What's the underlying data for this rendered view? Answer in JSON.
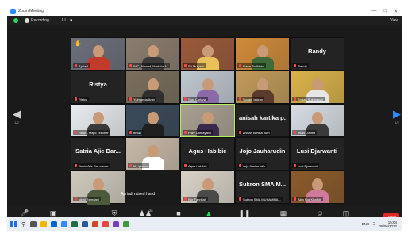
{
  "window": {
    "title": "Zoom Meeting",
    "controls": [
      "—",
      "□",
      "✕"
    ]
  },
  "topbar": {
    "recording": "Recording...",
    "pause": "II ■",
    "view": "View"
  },
  "pager": {
    "left_page": "1/2",
    "right_page": "1/2"
  },
  "tiles": [
    {
      "name": "Apriadi",
      "big": "",
      "kind": "video",
      "hand": true
    },
    {
      "name": "IMC_Ahmad Muntaha M.",
      "big": "",
      "kind": "video"
    },
    {
      "name": "Sri Mulyani",
      "big": "",
      "kind": "video"
    },
    {
      "name": "Liana Rofiktiani",
      "big": "",
      "kind": "video"
    },
    {
      "name": "Randy",
      "big": "Randy",
      "kind": "name"
    },
    {
      "name": "Ristya",
      "big": "Ristya",
      "kind": "name"
    },
    {
      "name": "Yulmanda Amir",
      "big": "",
      "kind": "video"
    },
    {
      "name": "Susi Coriana",
      "big": "",
      "kind": "video"
    },
    {
      "name": "Suyadi Iskiran",
      "big": "",
      "kind": "video"
    },
    {
      "name": "Endah Sukmawati",
      "big": "",
      "kind": "video"
    },
    {
      "name": "RBBI - Majid Teacher",
      "big": "",
      "kind": "video"
    },
    {
      "name": "Ifhida",
      "big": "",
      "kind": "video"
    },
    {
      "name": "Fuzy Damayanti",
      "big": "",
      "kind": "video",
      "active": true
    },
    {
      "name": "anisah kartika putri",
      "big": "anisah kartika p...",
      "kind": "name"
    },
    {
      "name": "Intan Dinima",
      "big": "",
      "kind": "video"
    },
    {
      "name": "Satria Ajie Darmawan",
      "big": "Satria Ajie Dar...",
      "kind": "name"
    },
    {
      "name": "My iphone",
      "big": "",
      "kind": "video"
    },
    {
      "name": "Agus Habibie",
      "big": "Agus Habibie",
      "kind": "name"
    },
    {
      "name": "Jojo Jauharudin",
      "big": "Jojo Jauharudin",
      "kind": "name"
    },
    {
      "name": "Lusi Djarwanti",
      "big": "Lusi Djarwanti",
      "kind": "name"
    },
    {
      "name": "Iqbal Ramdani",
      "big": "",
      "kind": "video",
      "raised": "Apriadi raised hand"
    },
    {
      "name": "",
      "big": "",
      "kind": "empty"
    },
    {
      "name": "Nur Fahrillah",
      "big": "",
      "kind": "video"
    },
    {
      "name": "Sukron SMA MUHAMMA...",
      "big": "Sukron SMA M...",
      "kind": "name"
    },
    {
      "name": "Alim Nur Khafidh",
      "big": "",
      "kind": "video"
    }
  ],
  "toolbar": {
    "unmute": "Unmute",
    "stop_video": "Stop Video",
    "security": "Security",
    "participants": "Participants",
    "participants_count": "28",
    "chat": "Chat",
    "share_screen": "Share Screen",
    "recording": "Pause/Stop Recording",
    "breakout": "Breakout Rooms",
    "reactions": "Reactions",
    "apps": "Apps",
    "leave": "Leave"
  },
  "taskbar": {
    "lang": "ENG",
    "time": "15:04",
    "date": "08/06/2022"
  },
  "colors": {
    "active_border": "#b4f05a",
    "leave": "#e02828",
    "share": "#23d959",
    "muted": "#ff4a4a"
  }
}
